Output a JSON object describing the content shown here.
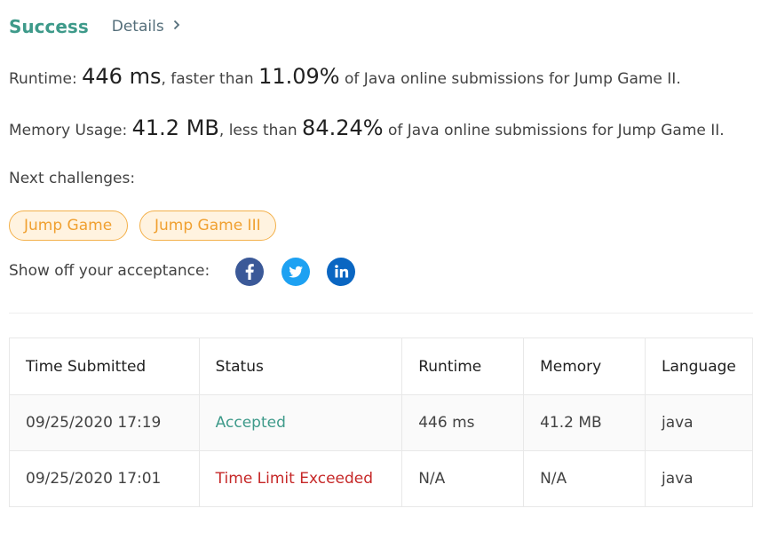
{
  "header": {
    "status": "Success",
    "details_label": "Details",
    "details_icon": "chevron-right-icon"
  },
  "runtime": {
    "label": "Runtime: ",
    "value": "446 ms",
    "middle": ", faster than ",
    "percent": "11.09%",
    "suffix": " of Java online submissions for Jump Game II."
  },
  "memory": {
    "label": "Memory Usage: ",
    "value": "41.2 MB",
    "middle": ", less than ",
    "percent": "84.24%",
    "suffix": " of Java online submissions for Jump Game II."
  },
  "next_challenges": {
    "label": "Next challenges:",
    "items": [
      {
        "label": "Jump Game"
      },
      {
        "label": "Jump Game III"
      }
    ]
  },
  "share": {
    "label": "Show off your acceptance:",
    "icons": [
      "facebook-icon",
      "twitter-icon",
      "linkedin-icon"
    ]
  },
  "table": {
    "headers": [
      "Time Submitted",
      "Status",
      "Runtime",
      "Memory",
      "Language"
    ],
    "rows": [
      {
        "time": "09/25/2020 17:19",
        "status": "Accepted",
        "runtime": "446 ms",
        "memory": "41.2 MB",
        "language": "java"
      },
      {
        "time": "09/25/2020 17:01",
        "status": "Time Limit Exceeded",
        "runtime": "N/A",
        "memory": "N/A",
        "language": "java"
      }
    ]
  },
  "colors": {
    "success": "#3e9a8a",
    "error": "#c62828",
    "chip_border": "#f3b04a",
    "chip_text": "#f0a030",
    "chip_bg": "#fff3e0",
    "facebook": "#3b5998",
    "twitter": "#1da1f2",
    "linkedin": "#0a66c2"
  }
}
